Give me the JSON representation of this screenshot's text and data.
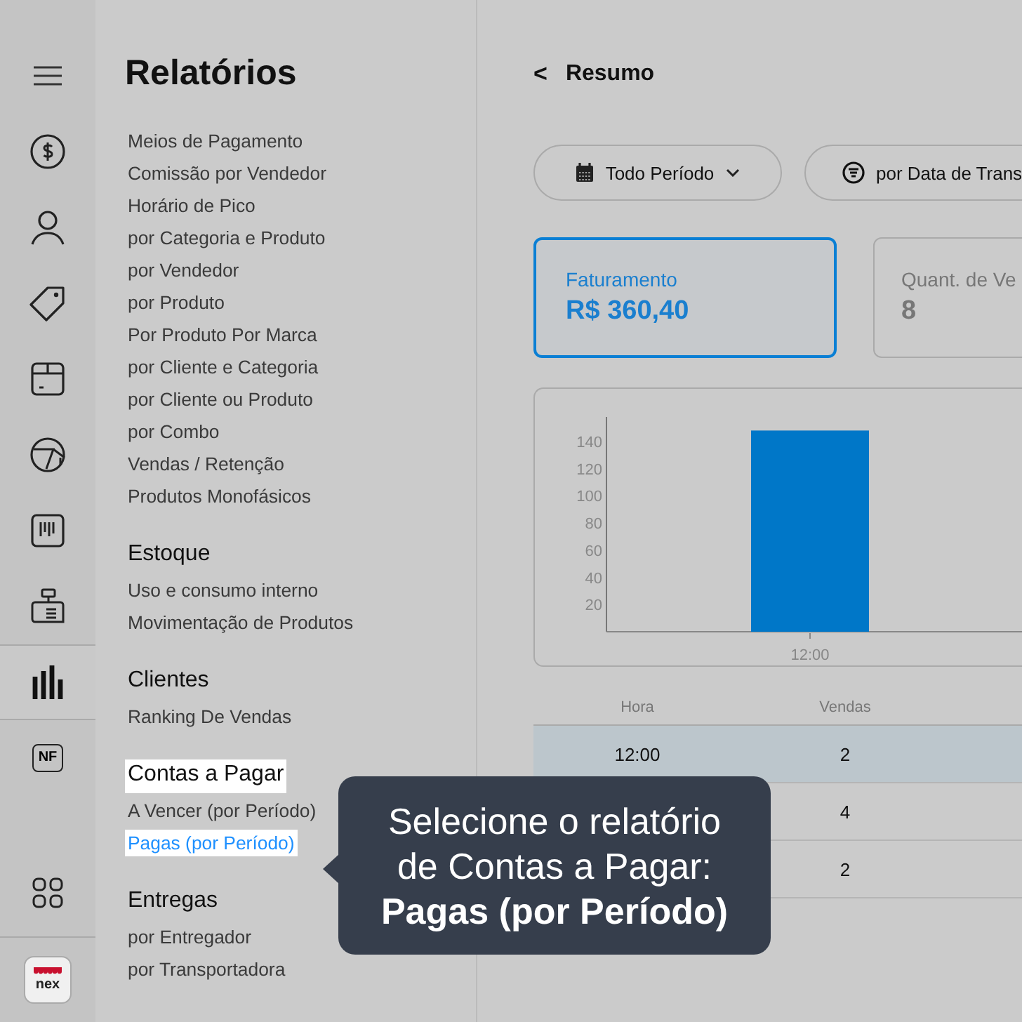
{
  "rail": [
    {
      "kind": "menu",
      "selected": false
    },
    {
      "kind": "dollar",
      "selected": false
    },
    {
      "kind": "person",
      "selected": false
    },
    {
      "kind": "tag",
      "selected": false
    },
    {
      "kind": "box",
      "selected": false
    },
    {
      "kind": "ball",
      "selected": false
    },
    {
      "kind": "barcode",
      "selected": false
    },
    {
      "kind": "register",
      "selected": false
    },
    {
      "kind": "chart",
      "selected": true
    },
    {
      "kind": "nf",
      "label": "NF",
      "selected": false
    }
  ],
  "rail_bottom": [
    {
      "kind": "grid"
    },
    {
      "kind": "logo",
      "label": "nex"
    }
  ],
  "sidebar": {
    "title": "Relatórios",
    "sections": [
      {
        "items": [
          {
            "label": "Meios de Pagamento",
            "highlighted": false
          },
          {
            "label": "Comissão por Vendedor",
            "highlighted": false
          },
          {
            "label": "Horário de Pico",
            "highlighted": false
          },
          {
            "label": "por Categoria e Produto",
            "highlighted": false
          },
          {
            "label": "por Vendedor",
            "highlighted": false
          },
          {
            "label": "por Produto",
            "highlighted": false
          },
          {
            "label": "Por Produto Por Marca",
            "highlighted": false
          },
          {
            "label": "por Cliente e Categoria",
            "highlighted": false
          },
          {
            "label": "por Cliente ou Produto",
            "highlighted": false
          },
          {
            "label": "por Combo",
            "highlighted": false
          },
          {
            "label": "Vendas / Retenção",
            "highlighted": false
          },
          {
            "label": "Produtos Monofásicos",
            "highlighted": false
          }
        ]
      },
      {
        "heading": "Estoque",
        "highlighted": false,
        "items": [
          {
            "label": "Uso e consumo interno",
            "highlighted": false
          },
          {
            "label": "Movimentação de Produtos",
            "highlighted": false
          }
        ]
      },
      {
        "heading": "Clientes",
        "highlighted": false,
        "items": [
          {
            "label": "Ranking De Vendas",
            "highlighted": false
          }
        ]
      },
      {
        "heading": "Contas a Pagar",
        "highlighted": true,
        "items": [
          {
            "label": "A Vencer (por Período)",
            "highlighted": false
          },
          {
            "label": "Pagas (por Período)",
            "highlighted": true
          }
        ]
      },
      {
        "heading": "Entregas",
        "highlighted": false,
        "items": [
          {
            "label": "por Entregador",
            "highlighted": false
          },
          {
            "label": "por Transportadora",
            "highlighted": false
          }
        ]
      }
    ]
  },
  "header": {
    "back": "<",
    "title": "Resumo"
  },
  "filters": [
    {
      "kind": "calendar",
      "label": "Todo Período"
    },
    {
      "kind": "filter",
      "label": "por Data de Trans"
    }
  ],
  "cards": [
    {
      "label": "Faturamento",
      "value": "R$ 360,40",
      "selected": true
    },
    {
      "label": "Quant. de Ve",
      "value": "8",
      "selected": false
    }
  ],
  "chart": {
    "chart_data": {
      "type": "bar",
      "categories": [
        "12:00"
      ],
      "values": [
        148
      ],
      "ylim": [
        0,
        158
      ],
      "yticks": [
        20,
        40,
        60,
        80,
        100,
        120,
        140
      ]
    }
  },
  "table": {
    "columns": [
      "Hora",
      "Vendas"
    ],
    "rows": [
      {
        "hora": "12:00",
        "vendas": "2",
        "selected": true
      },
      {
        "vendas": "4",
        "selected": false
      },
      {
        "vendas": "2",
        "selected": false
      }
    ]
  },
  "tooltip": {
    "lines": [
      "Selecione o relatório",
      "de Contas a Pagar:",
      "**Pagas (por Período)**"
    ]
  }
}
